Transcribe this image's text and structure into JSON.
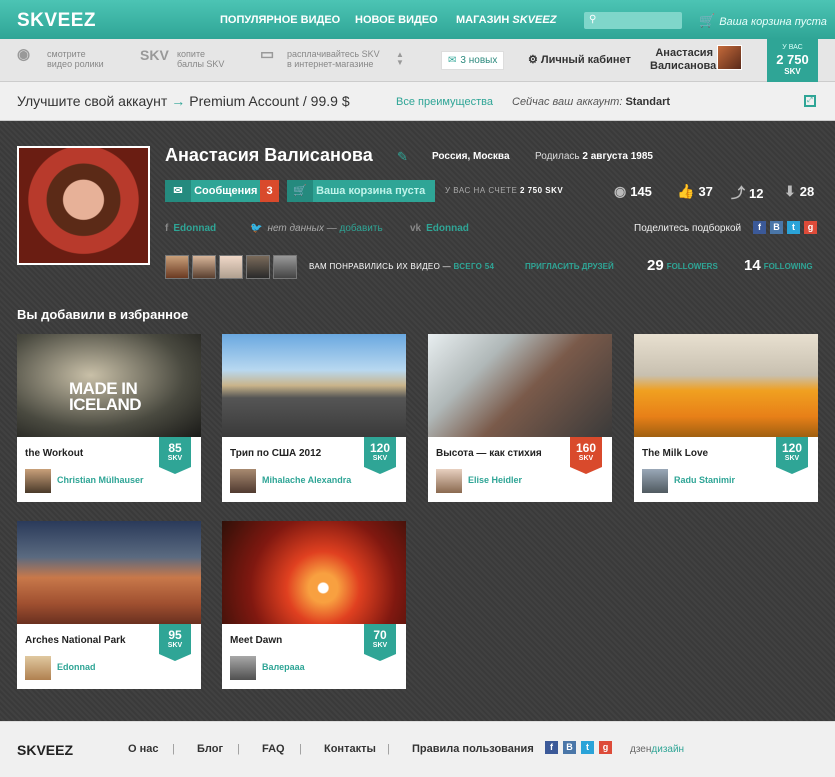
{
  "header": {
    "logo": "SKVEEZ",
    "nav": [
      {
        "label": "ПОПУЛЯРНОЕ ВИДЕО"
      },
      {
        "label": "НОВОЕ ВИДЕО"
      },
      {
        "label_a": "МАГАЗИН ",
        "label_b": "SKVEEZ"
      }
    ],
    "search_placeholder": "",
    "cart_text": "Ваша корзина пуста"
  },
  "subbar": {
    "tips": [
      {
        "icon": "eye-icon",
        "line1": "смотрите",
        "line2": "видео ролики"
      },
      {
        "big": "SKV",
        "line1": "копите",
        "line2": "баллы SKV"
      },
      {
        "icon": "card-icon",
        "line1": "расплачивайтесь SKV",
        "line2": "в интернет-магазине"
      }
    ],
    "messages": "3 новых",
    "cabinet": "Личный кабинет",
    "user_line1": "Анастасия",
    "user_line2": "Валисанова",
    "balance_label": "У ВАС",
    "balance_value": "2 750",
    "balance_unit": "SKV"
  },
  "premium": {
    "lead": "Улучшите свой аккаунт",
    "arrow": "→",
    "name": "Premium Account",
    "price": "/  99.9 $",
    "benefits": "Все преимущества",
    "current_label": "Сейчас ваш аккаунт: ",
    "current_value": "Standart"
  },
  "profile": {
    "name": "Анастасия Валисанова",
    "location": "Россия, Москва",
    "born_label": "Родилась ",
    "born_value": "2 августа 1985",
    "messages_btn": "Сообщения",
    "messages_count": "3",
    "cart_btn": "Ваша корзина пуста",
    "account_label": "У ВАС НА СЧЕТЕ ",
    "account_value": "2 750 SKV",
    "stats": {
      "views": "145",
      "likes": "37",
      "shares": "12",
      "downloads": "28"
    },
    "facebook": "Edonnad",
    "twitter_text": "нет данных —",
    "twitter_link": "добавить",
    "vk": "Edonnad",
    "share_label": "Поделитесь подборкой",
    "liked_text": "ВАМ ПОНРАВИЛИСЬ ИХ ВИДЕО  —",
    "liked_total": "ВСЕГО 54",
    "invite": "ПРИГЛАСИТЬ ДРУЗЕЙ",
    "followers_count": "29",
    "followers_label": "FOLLOWERS",
    "following_count": "14",
    "following_label": "FOLLOWING"
  },
  "favorites": {
    "title": "Вы добавили в избранное",
    "cards": [
      {
        "title": "the Workout",
        "author": "Christian Mülhauser",
        "skv": "85",
        "unit": "SKV",
        "overlay1": "MADE IN",
        "overlay2": "ICELAND"
      },
      {
        "title": "Трип по США 2012",
        "author": "Mihalache Alexandra",
        "skv": "120",
        "unit": "SKV"
      },
      {
        "title": "Высота — как стихия",
        "author": "Elise Heidler",
        "skv": "160",
        "unit": "SKV"
      },
      {
        "title": "The Milk Love",
        "author": "Radu Stanimir",
        "skv": "120",
        "unit": "SKV"
      },
      {
        "title": "Arches National Park",
        "author": "Edonnad",
        "skv": "95",
        "unit": "SKV"
      },
      {
        "title": "Meet Dawn",
        "author": "Валераaa",
        "skv": "70",
        "unit": "SKV"
      }
    ]
  },
  "footer": {
    "logo": "SKVEEZ",
    "links": [
      "О нас",
      "Блог",
      "FAQ",
      "Контакты",
      "Правила пользования"
    ],
    "sep": "|",
    "dzen_a": "дзен",
    "dzen_b": "дизайн"
  },
  "colors": {
    "accent": "#2fa596",
    "alert": "#d94a2c"
  }
}
